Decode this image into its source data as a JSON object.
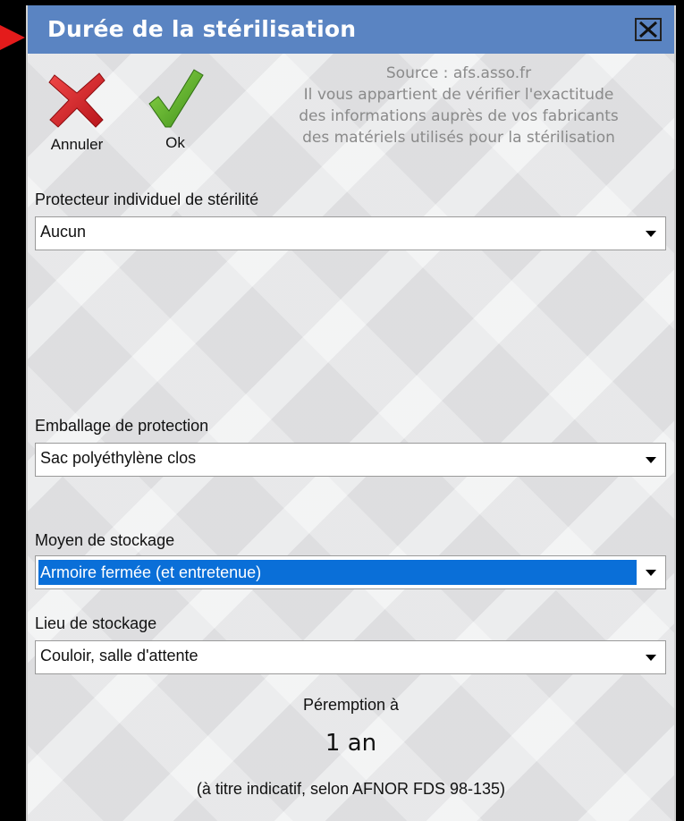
{
  "window": {
    "title": "Durée de la stérilisation",
    "close_label": "X"
  },
  "toolbar": {
    "cancel_label": "Annuler",
    "ok_label": "Ok"
  },
  "source": {
    "line1": "Source : afs.asso.fr",
    "line2": "Il vous appartient de vérifier l'exactitude",
    "line3": "des informations auprès de vos fabricants",
    "line4": "des matériels utilisés pour la stérilisation"
  },
  "fields": {
    "protecteur": {
      "label": "Protecteur individuel de stérilité",
      "value": "Aucun"
    },
    "emballage": {
      "label": "Emballage de protection",
      "value": "Sac polyéthylène clos"
    },
    "moyen": {
      "label": "Moyen de stockage",
      "value": "Armoire fermée (et entretenue)"
    },
    "lieu": {
      "label": "Lieu de stockage",
      "value": "Couloir, salle d'attente"
    }
  },
  "result": {
    "heading": "Péremption à",
    "value": "1 an",
    "note": "(à titre indicatif, selon AFNOR FDS 98-135)"
  },
  "colors": {
    "titlebar": "#5a84c2",
    "selection": "#0a6fd8",
    "cancel_icon": "#d0272d",
    "ok_icon": "#5bb025"
  },
  "icons": {
    "pointer": "red-arrow-icon",
    "close": "close-icon",
    "cancel": "red-x-icon",
    "ok": "green-check-icon",
    "dropdown": "caret-down-icon"
  }
}
